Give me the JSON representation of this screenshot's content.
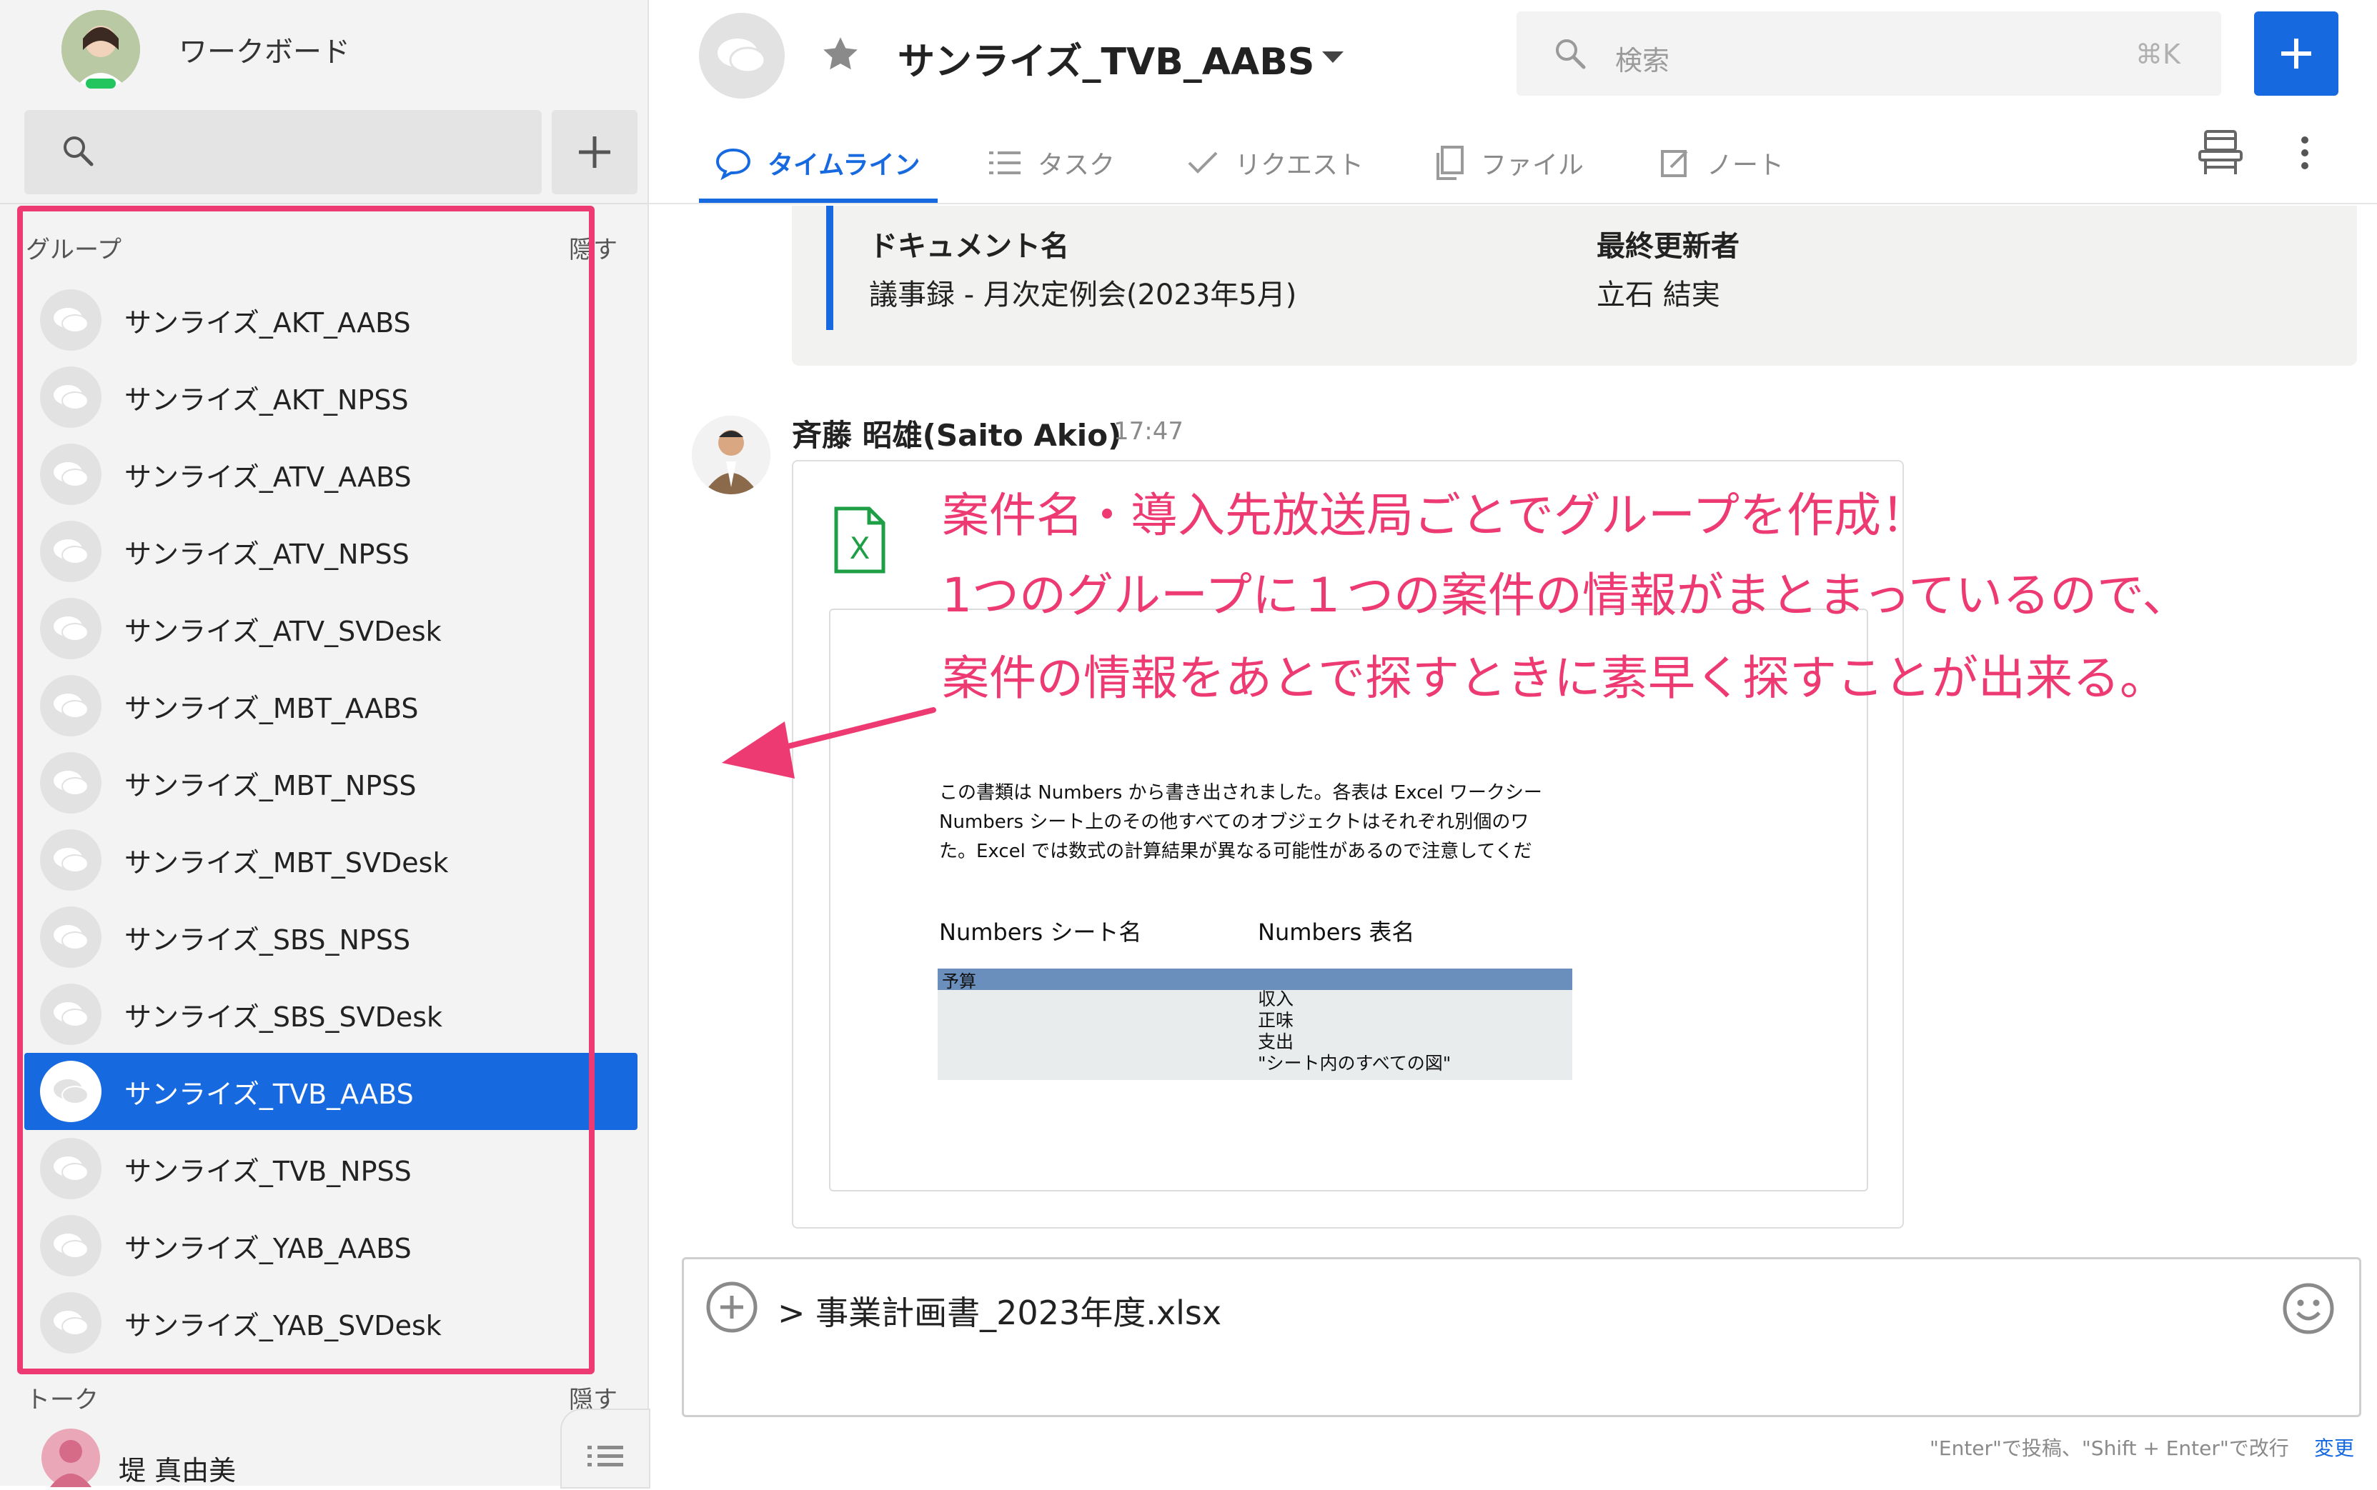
{
  "sidebar": {
    "workspace_name": "ワークボード",
    "groups_header": "グループ",
    "groups_hide": "隠す",
    "groups": [
      {
        "label": "サンライズ_AKT_AABS",
        "active": false
      },
      {
        "label": "サンライズ_AKT_NPSS",
        "active": false
      },
      {
        "label": "サンライズ_ATV_AABS",
        "active": false
      },
      {
        "label": "サンライズ_ATV_NPSS",
        "active": false
      },
      {
        "label": "サンライズ_ATV_SVDesk",
        "active": false
      },
      {
        "label": "サンライズ_MBT_AABS",
        "active": false
      },
      {
        "label": "サンライズ_MBT_NPSS",
        "active": false
      },
      {
        "label": "サンライズ_MBT_SVDesk",
        "active": false
      },
      {
        "label": "サンライズ_SBS_NPSS",
        "active": false
      },
      {
        "label": "サンライズ_SBS_SVDesk",
        "active": false
      },
      {
        "label": "サンライズ_TVB_AABS",
        "active": true
      },
      {
        "label": "サンライズ_TVB_NPSS",
        "active": false
      },
      {
        "label": "サンライズ_YAB_AABS",
        "active": false
      },
      {
        "label": "サンライズ_YAB_SVDesk",
        "active": false
      }
    ],
    "talk_header": "トーク",
    "talk_hide": "隠す",
    "talk_user": "堤 真由美"
  },
  "header": {
    "channel_title": "サンライズ_TVB_AABS",
    "search_placeholder": "検索",
    "search_shortcut": "⌘K",
    "tabs": [
      {
        "label": "タイムライン",
        "icon": "chat-bubble-icon",
        "active": true
      },
      {
        "label": "タスク",
        "icon": "list-icon",
        "active": false
      },
      {
        "label": "リクエスト",
        "icon": "check-icon",
        "active": false
      },
      {
        "label": "ファイル",
        "icon": "file-copy-icon",
        "active": false
      },
      {
        "label": "ノート",
        "icon": "note-edit-icon",
        "active": false
      }
    ]
  },
  "doc_card": {
    "name_header": "ドキュメント名",
    "name_value": "議事録 - 月次定例会(2023年5月)",
    "updater_header": "最終更新者",
    "updater_value": "立石 結実"
  },
  "message": {
    "author": "斉藤 昭雄(Saito Akio)",
    "time": "17:47",
    "preview_lines": [
      "この書類は Numbers から書き出されました。各表は Excel ワークシー",
      "Numbers シート上のその他すべてのオブジェクトはそれぞれ別個のワ",
      "た。Excel では数式の計算結果が異なる可能性があるので注意してくだ"
    ],
    "preview_col1": "Numbers シート名",
    "preview_col2": "Numbers 表名",
    "preview_table_head": "予算",
    "preview_items": [
      "収入",
      "正味",
      "支出",
      "\"シート内のすべての図\""
    ]
  },
  "annotation": {
    "line1": "案件名・導入先放送局ごとでグループを作成！",
    "line2": "1つのグループに１つの案件の情報がまとまっているので、",
    "line3": "案件の情報をあとで探すときに素早く探すことが出来る。",
    "color": "#ee3a72"
  },
  "composer": {
    "text": "> 事業計画書_2023年度.xlsx",
    "hint": "\"Enter\"で投稿、\"Shift + Enter\"で改行",
    "change_link": "変更"
  },
  "colors": {
    "accent": "#1769e0",
    "highlight": "#ee3a72",
    "excel": "#1e9e45"
  }
}
